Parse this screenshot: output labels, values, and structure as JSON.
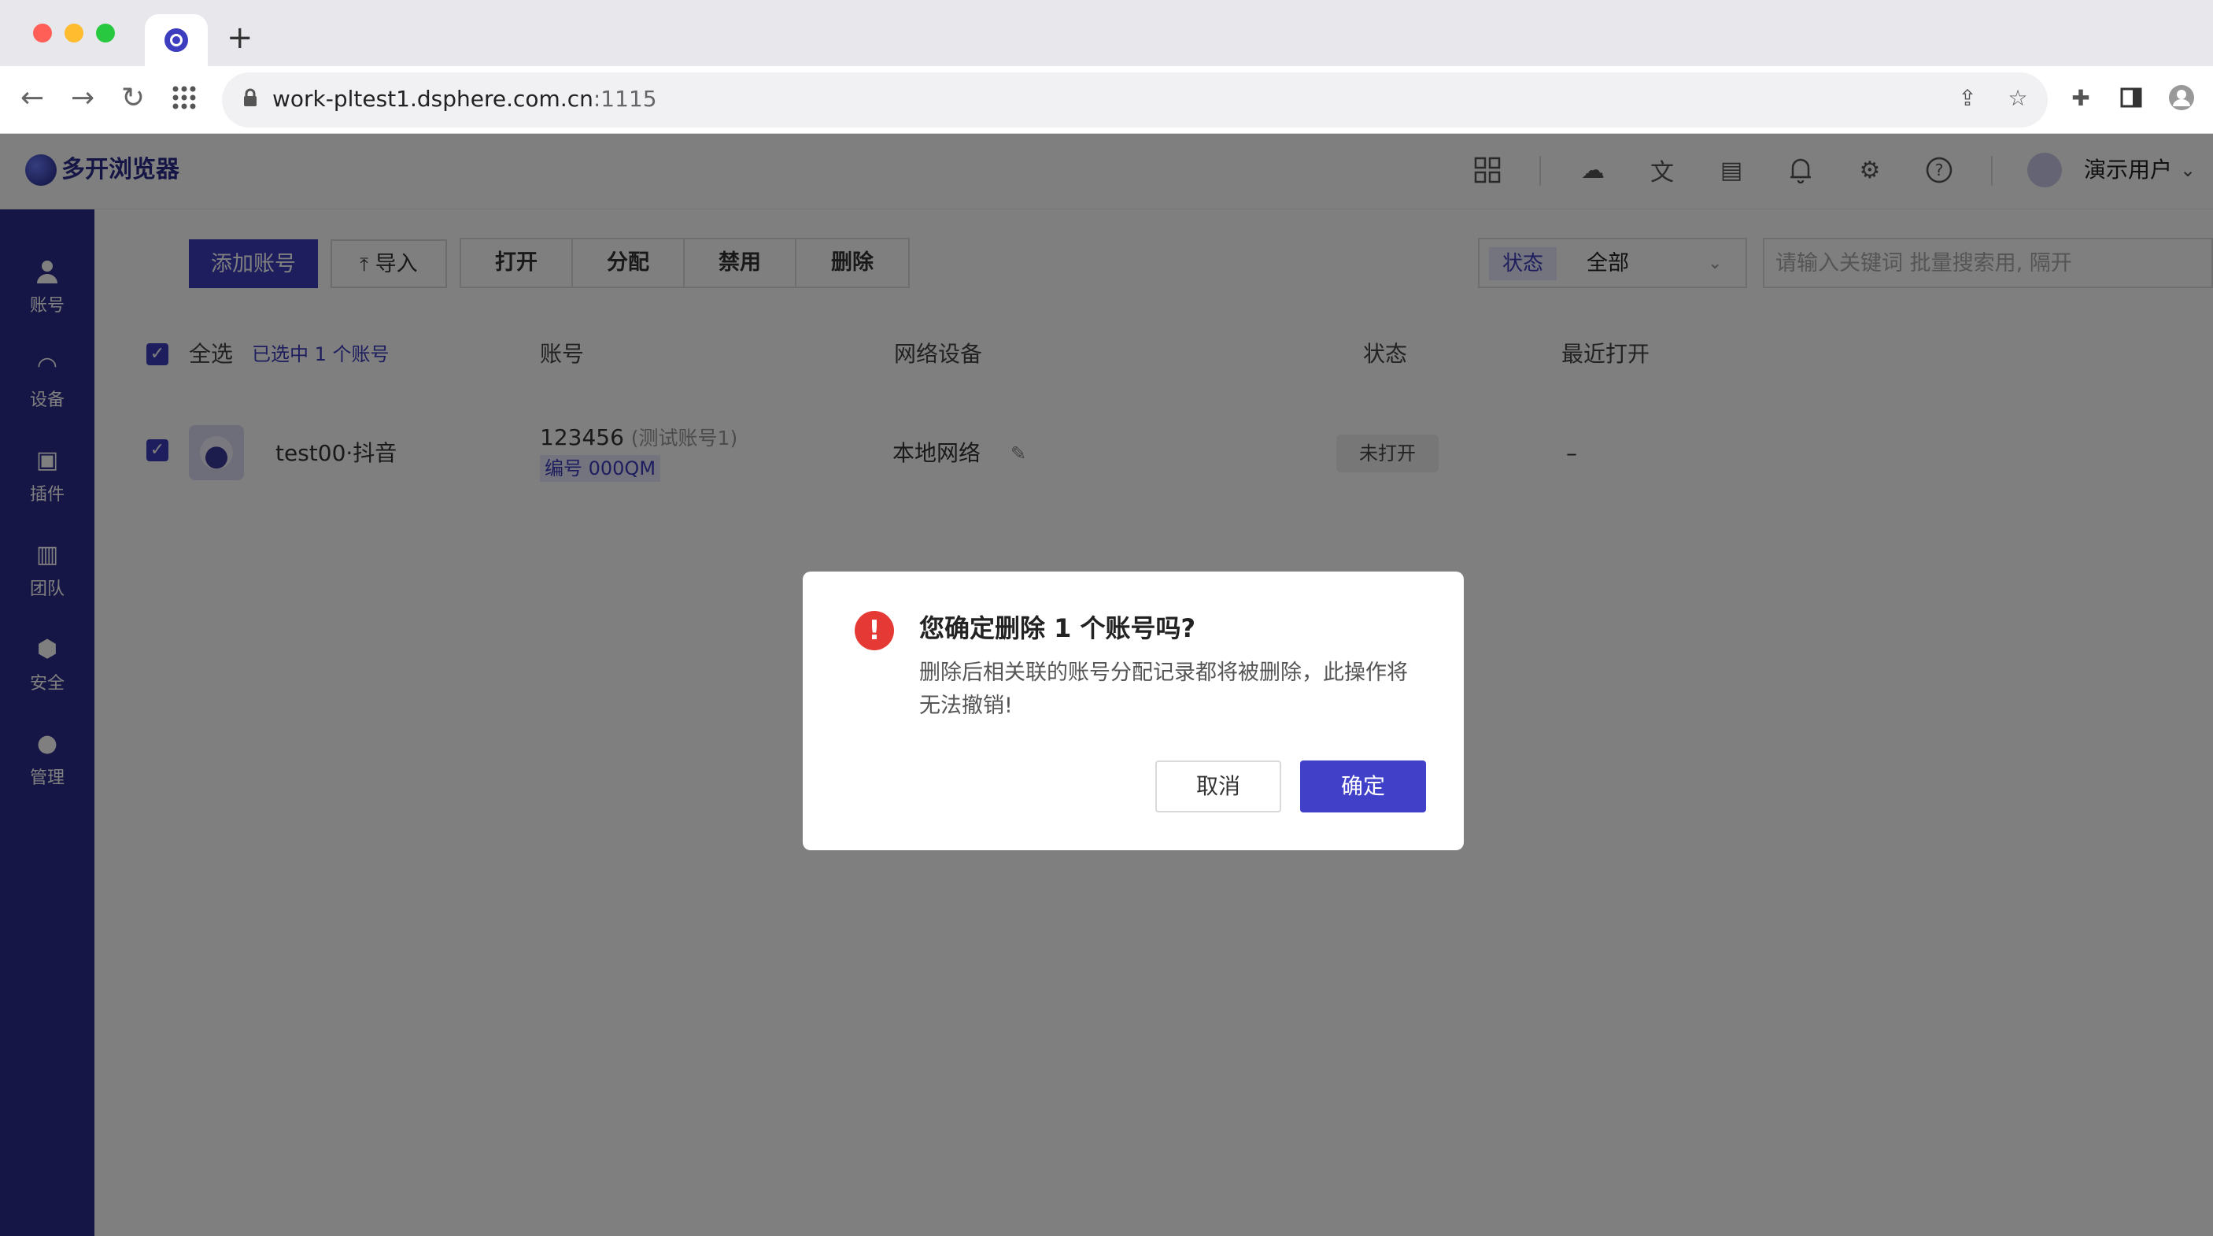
{
  "browser": {
    "url_host": "work-pltest1.dsphere.com.cn",
    "url_port": ":1115",
    "new_tab_glyph": "+"
  },
  "app": {
    "name": "多开浏览器",
    "user_name": "演示用户"
  },
  "sidebar": {
    "items": [
      {
        "label": "账号",
        "icon": "user-icon",
        "active": true
      },
      {
        "label": "设备",
        "icon": "wifi-icon"
      },
      {
        "label": "插件",
        "icon": "plugin-icon"
      },
      {
        "label": "团队",
        "icon": "building-icon"
      },
      {
        "label": "安全",
        "icon": "shield-icon"
      },
      {
        "label": "管理",
        "icon": "settings-icon"
      }
    ]
  },
  "toolbar": {
    "add_account": "添加账号",
    "import": "导入",
    "open": "打开",
    "assign": "分配",
    "disable": "禁用",
    "delete": "删除",
    "status_tag": "状态",
    "status_value": "全部",
    "search_placeholder": "请输入关键词 批量搜索用, 隔开"
  },
  "table": {
    "select_all": "全选",
    "selected_info": "已选中 1 个账号",
    "headers": {
      "account": "账号",
      "network": "网络设备",
      "status": "状态",
      "last_open": "最近打开"
    },
    "rows": [
      {
        "name": "test00·抖音",
        "account_id": "123456",
        "account_note": "(测试账号1)",
        "code": "编号 000QM",
        "network": "本地网络",
        "status": "未打开",
        "last_open": "–"
      }
    ]
  },
  "dialog": {
    "title": "您确定删除 1 个账号吗?",
    "body": "删除后相关联的账号分配记录都将被删除，此操作将无法撤销!",
    "cancel": "取消",
    "confirm": "确定",
    "icon_glyph": "!"
  },
  "colors": {
    "brand": "#3d3dbf",
    "sidebar": "#2b2b8c",
    "danger": "#e53935"
  }
}
